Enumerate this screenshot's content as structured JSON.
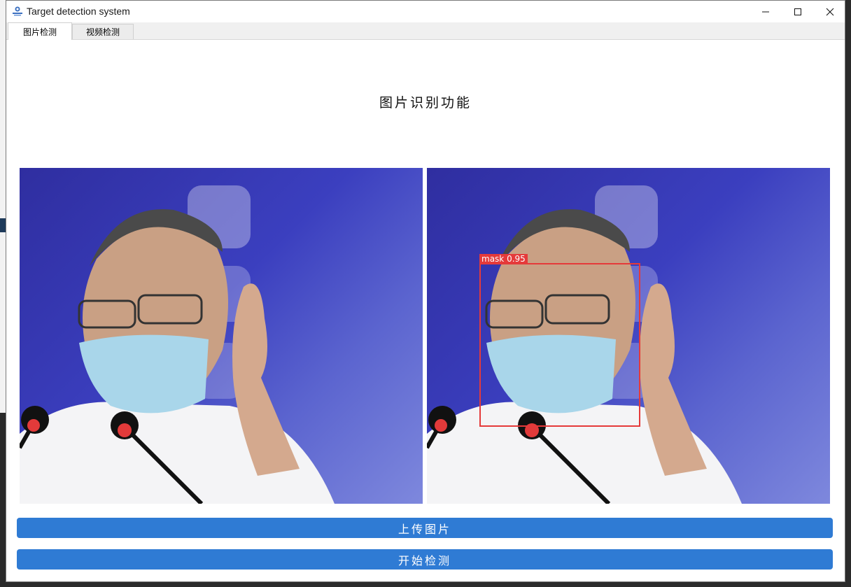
{
  "window": {
    "title": "Target detection system",
    "controls": {
      "minimize_icon": "minimize-icon",
      "maximize_icon": "maximize-icon",
      "close_icon": "close-icon"
    }
  },
  "tabs": [
    {
      "label": "图片检测",
      "active": true
    },
    {
      "label": "视频检测",
      "active": false
    }
  ],
  "main": {
    "heading": "图片识别功能",
    "detection": {
      "label": "mask",
      "confidence": "0.95",
      "color": "#e53a3a"
    },
    "upload_button": "上传图片",
    "detect_button": "开始检测"
  },
  "colors": {
    "accent": "#2f7bd4",
    "box": "#e53a3a"
  }
}
